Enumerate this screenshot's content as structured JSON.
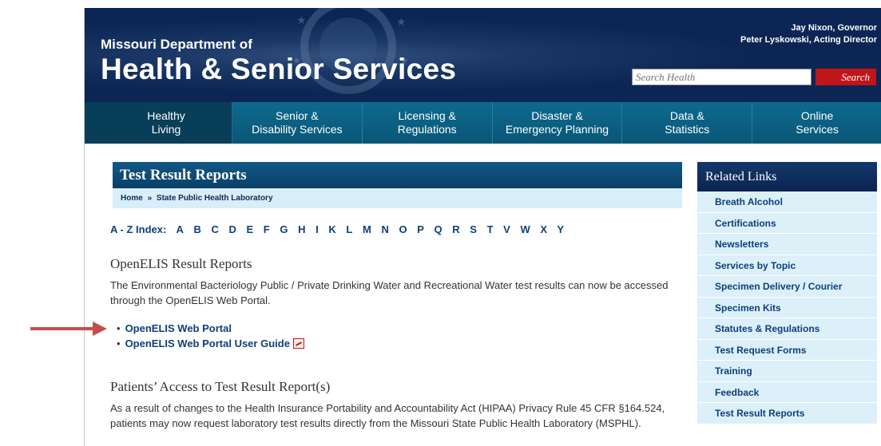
{
  "header": {
    "department": "Missouri Department of",
    "agency": "Health & Senior Services",
    "governor": "Jay Nixon, Governor",
    "director": "Peter Lyskowski, Acting Director",
    "search_placeholder": "Search Health",
    "search_button": "Search",
    "colors": {
      "header_bg": "#0b2654",
      "search_button": "#c0161a"
    }
  },
  "nav": [
    {
      "line1": "Healthy",
      "line2": "Living"
    },
    {
      "line1": "Senior &",
      "line2": "Disability Services"
    },
    {
      "line1": "Licensing &",
      "line2": "Regulations"
    },
    {
      "line1": "Disaster &",
      "line2": "Emergency Planning"
    },
    {
      "line1": "Data &",
      "line2": "Statistics"
    },
    {
      "line1": "Online",
      "line2": "Services"
    }
  ],
  "main": {
    "title": "Test Result Reports",
    "breadcrumb": {
      "home": "Home",
      "separator": "»",
      "current": "State Public Health Laboratory"
    },
    "az_index": {
      "label": "A - Z Index:",
      "letters": [
        "A",
        "B",
        "C",
        "D",
        "E",
        "F",
        "G",
        "H",
        "I",
        "K",
        "L",
        "M",
        "N",
        "O",
        "P",
        "Q",
        "R",
        "S",
        "T",
        "V",
        "W",
        "X",
        "Y"
      ]
    },
    "section1": {
      "heading": "OpenELIS Result Reports",
      "text": "The Environmental Bacteriology Public / Private Drinking Water and Recreational Water test results can now be accessed through the OpenELIS Web Portal.",
      "links": [
        "OpenELIS Web Portal",
        "OpenELIS Web Portal User Guide"
      ]
    },
    "section2": {
      "heading": "Patients’ Access to Test Result Report(s)",
      "text": "As a result of changes to the Health Insurance Portability and Accountability Act (HIPAA) Privacy Rule 45 CFR §164.524, patients may now request laboratory test results directly from the Missouri State Public Health Laboratory (MSPHL)."
    }
  },
  "related": {
    "title": "Related Links",
    "items": [
      "Breath Alcohol",
      "Certifications",
      "Newsletters",
      "Services by Topic",
      "Specimen Delivery / Courier",
      "Specimen Kits",
      "Statutes & Regulations",
      "Test Request Forms",
      "Training",
      "Feedback",
      "Test Result Reports"
    ]
  },
  "annotation": {
    "arrow_color": "#c0504d"
  }
}
